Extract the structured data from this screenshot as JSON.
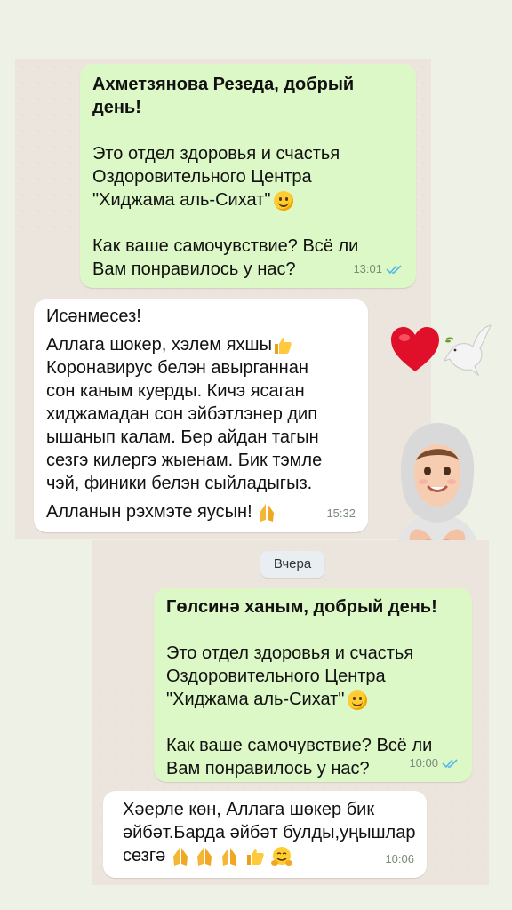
{
  "conversation_top": {
    "out_message": {
      "lines": [
        "Ахметзянова Резеда, добрый",
        "день!",
        "",
        "Это отдел здоровья и счастья",
        "Оздоровительного Центра",
        "\"Хиджама аль-Сихат\"",
        "",
        "Как ваше самочувствие? Всё ли",
        "Вам понравилось у нас?"
      ],
      "time": "13:01"
    },
    "in_message": {
      "lines": [
        "Исәнмесез!",
        "Аллага шокер, хэлем яхшы",
        "Коронавирус белэн авырганнан",
        "сон каным куерды. Кичэ ясаган",
        "хиджамадан сон эйбэтлэнер дип",
        "ышанып калам. Бер айдан тагын",
        "сезгэ килергэ жыенам. Бик тэмле",
        "чэй, финики белэн сыйладыгыз.",
        "Алланын рэхмэте яусын!"
      ],
      "time": "15:32"
    }
  },
  "conversation_bottom": {
    "date_separator": "Вчера",
    "out_message": {
      "lines": [
        "Гөлсинә ханым, добрый день!",
        "",
        "Это отдел здоровья и счастья",
        "Оздоровительного Центра",
        "\"Хиджама аль-Сихат\"",
        "",
        "Как ваше самочувствие? Всё ли",
        "Вам понравилось у нас?"
      ],
      "time": "10:00"
    },
    "in_message": {
      "lines": [
        "Хәерле көн, Аллага шөкер бик",
        "әйбәт.Барда әйбәт булды,уңышлар",
        "сезгә"
      ],
      "time": "10:06"
    }
  },
  "decorations": {
    "heart_icon": "heart-icon",
    "dove_icon": "dove-icon",
    "avatar": "hijab-girl-avatar",
    "colors": {
      "outgoing_bubble": "#dcf8c6",
      "incoming_bubble": "#ffffff",
      "read_ticks": "#4fb6ec",
      "heart": "#e0102a"
    }
  }
}
